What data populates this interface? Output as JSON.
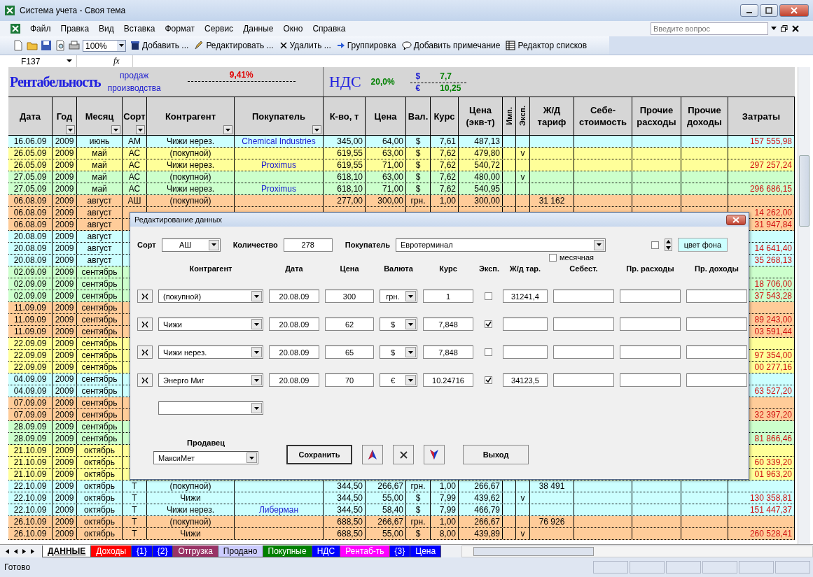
{
  "window": {
    "title": "Система учета  - Своя тема"
  },
  "menu": [
    "Файл",
    "Правка",
    "Вид",
    "Вставка",
    "Формат",
    "Сервис",
    "Данные",
    "Окно",
    "Справка"
  ],
  "help": {
    "placeholder": "Введите вопрос"
  },
  "toolbar": {
    "zoom": "100%",
    "items": [
      {
        "kind": "add",
        "label": "Добавить ..."
      },
      {
        "kind": "edit",
        "label": "Редактировать ..."
      },
      {
        "kind": "delete",
        "label": "Удалить ..."
      },
      {
        "kind": "group",
        "label": "Группировка"
      },
      {
        "kind": "comment",
        "label": "Добавить примечание"
      },
      {
        "kind": "lists",
        "label": "Редактор списков"
      }
    ]
  },
  "formula_bar": {
    "cell": "F137",
    "fx": "fx"
  },
  "summary": {
    "title": "Рентабельность",
    "sales_label": "продаж",
    "production_label": "производства",
    "profitability": "9,41%",
    "vat_title": "НДС",
    "vat": "20,0%",
    "usd_sign": "$",
    "usd": "7,7",
    "eur_sign": "€",
    "eur": "10,25"
  },
  "columns": [
    {
      "label": "Дата",
      "filter": false
    },
    {
      "label": "Год",
      "filter": true
    },
    {
      "label": "Месяц",
      "filter": true
    },
    {
      "label": "Сорт",
      "filter": true
    },
    {
      "label": "Контрагент",
      "filter": true
    },
    {
      "label": "Покупатель",
      "filter": true
    },
    {
      "label": "К-во, т",
      "filter": false
    },
    {
      "label": "Цена",
      "filter": false
    },
    {
      "label": "Вал.",
      "filter": false
    },
    {
      "label": "Курс",
      "filter": false
    },
    {
      "label": "Цена (экв-т)",
      "filter": false
    },
    {
      "label": "Имп.",
      "filter": false
    },
    {
      "label": "Эксп.",
      "filter": false
    },
    {
      "label": "Ж/Д тариф",
      "filter": false
    },
    {
      "label": "Себе-стоимость",
      "filter": false
    },
    {
      "label": "Прочие расходы",
      "filter": false
    },
    {
      "label": "Прочие доходы",
      "filter": false
    },
    {
      "label": "Затраты",
      "filter": false
    }
  ],
  "rows": [
    {
      "color": "#ccffff",
      "date": "16.06.09",
      "year": "2009",
      "month": "июнь",
      "grade": "АМ",
      "counterparty": "Чижи нерез.",
      "buyer": "Chemical Industries",
      "qty": "345,00",
      "price": "64,00",
      "currency": "$",
      "rate": "7,61",
      "price_eq": "487,13",
      "cost": "157 555,98"
    },
    {
      "color": "#ffff99",
      "date": "26.05.09",
      "year": "2009",
      "month": "май",
      "grade": "АС",
      "counterparty": "(покупной)",
      "qty": "619,55",
      "price": "63,00",
      "currency": "$",
      "rate": "7,62",
      "price_eq": "479,80",
      "exp": "v"
    },
    {
      "color": "#ffff99",
      "date": "26.05.09",
      "year": "2009",
      "month": "май",
      "grade": "АС",
      "counterparty": "Чижи нерез.",
      "buyer": "Proximus",
      "qty": "619,55",
      "price": "71,00",
      "currency": "$",
      "rate": "7,62",
      "price_eq": "540,72",
      "cost": "297 257,24"
    },
    {
      "color": "#ccffcc",
      "date": "27.05.09",
      "year": "2009",
      "month": "май",
      "grade": "АС",
      "counterparty": "(покупной)",
      "qty": "618,10",
      "price": "63,00",
      "currency": "$",
      "rate": "7,62",
      "price_eq": "480,00",
      "exp": "v"
    },
    {
      "color": "#ccffcc",
      "date": "27.05.09",
      "year": "2009",
      "month": "май",
      "grade": "АС",
      "counterparty": "Чижи нерез.",
      "buyer": "Proximus",
      "qty": "618,10",
      "price": "71,00",
      "currency": "$",
      "rate": "7,62",
      "price_eq": "540,95",
      "cost": "296 686,15"
    },
    {
      "color": "#ffcc99",
      "date": "06.08.09",
      "year": "2009",
      "month": "август",
      "grade": "АШ",
      "counterparty": "(покупной)",
      "qty": "277,00",
      "price": "300,00",
      "currency": "грн.",
      "rate": "1,00",
      "price_eq": "300,00",
      "rail": "31 162"
    },
    {
      "color": "#ffcc99",
      "date": "06.08.09",
      "year": "2009",
      "month": "август",
      "cost": "14 262,00"
    },
    {
      "color": "#ffcc99",
      "date": "06.08.09",
      "year": "2009",
      "month": "август",
      "cost": "31 947,84"
    },
    {
      "color": "#ccffff",
      "date": "20.08.09",
      "year": "2009",
      "month": "август"
    },
    {
      "color": "#ccffff",
      "date": "20.08.09",
      "year": "2009",
      "month": "август",
      "cost": "14 641,40"
    },
    {
      "color": "#ccffff",
      "date": "20.08.09",
      "year": "2009",
      "month": "август",
      "cost": "35 268,13"
    },
    {
      "color": "#ccffcc",
      "date": "02.09.09",
      "year": "2009",
      "month": "сентябрь"
    },
    {
      "color": "#ccffcc",
      "date": "02.09.09",
      "year": "2009",
      "month": "сентябрь",
      "cost": "18 706,00"
    },
    {
      "color": "#ccffcc",
      "date": "02.09.09",
      "year": "2009",
      "month": "сентябрь",
      "cost": "37 543,28"
    },
    {
      "color": "#ffcc99",
      "date": "11.09.09",
      "year": "2009",
      "month": "сентябрь"
    },
    {
      "color": "#ffcc99",
      "date": "11.09.09",
      "year": "2009",
      "month": "сентябрь",
      "cost": "89 243,00"
    },
    {
      "color": "#ffcc99",
      "date": "11.09.09",
      "year": "2009",
      "month": "сентябрь",
      "cost": "03 591,44"
    },
    {
      "color": "#ffff99",
      "date": "22.09.09",
      "year": "2009",
      "month": "сентябрь"
    },
    {
      "color": "#ffff99",
      "date": "22.09.09",
      "year": "2009",
      "month": "сентябрь",
      "cost": "97 354,00"
    },
    {
      "color": "#ffff99",
      "date": "22.09.09",
      "year": "2009",
      "month": "сентябрь",
      "cost": "00 277,16"
    },
    {
      "color": "#ccffff",
      "date": "04.09.09",
      "year": "2009",
      "month": "сентябрь"
    },
    {
      "color": "#ccffff",
      "date": "04.09.09",
      "year": "2009",
      "month": "сентябрь",
      "cost": "63 527,20"
    },
    {
      "color": "#ffcc99",
      "date": "07.09.09",
      "year": "2009",
      "month": "сентябрь"
    },
    {
      "color": "#ffcc99",
      "date": "07.09.09",
      "year": "2009",
      "month": "сентябрь",
      "cost": "32 397,20"
    },
    {
      "color": "#ccffcc",
      "date": "28.09.09",
      "year": "2009",
      "month": "сентябрь"
    },
    {
      "color": "#ccffcc",
      "date": "28.09.09",
      "year": "2009",
      "month": "сентябрь",
      "cost": "81 866,46"
    },
    {
      "color": "#ffff99",
      "date": "21.10.09",
      "year": "2009",
      "month": "октябрь"
    },
    {
      "color": "#ffff99",
      "date": "21.10.09",
      "year": "2009",
      "month": "октябрь",
      "cost": "60 339,20"
    },
    {
      "color": "#ffff99",
      "date": "21.10.09",
      "year": "2009",
      "month": "октябрь",
      "cost": "01 963,20"
    },
    {
      "color": "#ccffff",
      "date": "22.10.09",
      "year": "2009",
      "month": "октябрь",
      "grade": "Т",
      "counterparty": "(покупной)",
      "qty": "344,50",
      "price": "266,67",
      "currency": "грн.",
      "rate": "1,00",
      "price_eq": "266,67",
      "rail": "38 491"
    },
    {
      "color": "#ccffff",
      "date": "22.10.09",
      "year": "2009",
      "month": "октябрь",
      "grade": "Т",
      "counterparty": "Чижи",
      "qty": "344,50",
      "price": "55,00",
      "currency": "$",
      "rate": "7,99",
      "price_eq": "439,62",
      "exp": "v",
      "cost": "130 358,81"
    },
    {
      "color": "#ccffff",
      "date": "22.10.09",
      "year": "2009",
      "month": "октябрь",
      "grade": "Т",
      "counterparty": "Чижи нерез.",
      "buyer": "Либерман",
      "qty": "344,50",
      "price": "58,40",
      "currency": "$",
      "rate": "7,99",
      "price_eq": "466,79",
      "cost": "151 447,37"
    },
    {
      "color": "#ffcc99",
      "date": "26.10.09",
      "year": "2009",
      "month": "октябрь",
      "grade": "Т",
      "counterparty": "(покупной)",
      "qty": "688,50",
      "price": "266,67",
      "currency": "грн.",
      "rate": "1,00",
      "price_eq": "266,67",
      "rail": "76 926"
    },
    {
      "color": "#ffcc99",
      "date": "26.10.09",
      "year": "2009",
      "month": "октябрь",
      "grade": "Т",
      "counterparty": "Чижи",
      "qty": "688,50",
      "price": "55,00",
      "currency": "$",
      "rate": "8,00",
      "price_eq": "439,89",
      "exp": "v",
      "cost": "260 528,41"
    }
  ],
  "sheet_tabs": [
    {
      "label": "ДАННЫЕ",
      "selected": true,
      "color": "#ffffff"
    },
    {
      "label": "Доходы",
      "selected": false,
      "color": "#ff0000"
    },
    {
      "label": "{1}",
      "selected": false,
      "color": "#0000ff"
    },
    {
      "label": "{2}",
      "selected": false,
      "color": "#0000ff"
    },
    {
      "label": "Отгрузка",
      "selected": false,
      "color": "#993366"
    },
    {
      "label": "Продано",
      "selected": false,
      "color": "#ccccff"
    },
    {
      "label": "Покупные",
      "selected": false,
      "color": "#008000"
    },
    {
      "label": "НДС",
      "selected": false,
      "color": "#0000ff"
    },
    {
      "label": "Рентаб-ть",
      "selected": false,
      "color": "#ff00ff"
    },
    {
      "label": "{3}",
      "selected": false,
      "color": "#0000ff"
    },
    {
      "label": "Цена",
      "selected": false,
      "color": "#0000ff"
    }
  ],
  "status_bar": {
    "text": "Готово"
  },
  "dialog": {
    "title": "Редактирование данных",
    "grade_label": "Сорт",
    "grade": "АШ",
    "qty_label": "Количество",
    "qty": "278",
    "buyer_label": "Покупатель",
    "buyer": "Евротерминал",
    "bg_checked": false,
    "bg_color_label": "цвет фона",
    "monthly_label": "месячная",
    "monthly": false,
    "headers": [
      "Контрагент",
      "Дата",
      "Цена",
      "Валюта",
      "Курс",
      "Эксп.",
      "Ж/д тар.",
      "Себест.",
      "Пр. расходы",
      "Пр. доходы"
    ],
    "lines": [
      {
        "counterparty": "(покупной)",
        "date": "20.08.09",
        "price": "300",
        "currency": "грн.",
        "rate": "1",
        "exp": false,
        "rail": "31241,4"
      },
      {
        "counterparty": "Чижи",
        "date": "20.08.09",
        "price": "62",
        "currency": "$",
        "rate": "7,848",
        "exp": true
      },
      {
        "counterparty": "Чижи нерез.",
        "date": "20.08.09",
        "price": "65",
        "currency": "$",
        "rate": "7,848",
        "exp": false
      },
      {
        "counterparty": "Энерго Миг",
        "date": "20.08.09",
        "price": "70",
        "currency": "€",
        "rate": "10.24716",
        "exp": true,
        "rail": "34123,5"
      }
    ],
    "seller_label": "Продавец",
    "seller": "МаксиМет",
    "buttons": [
      {
        "kind": "save",
        "label": "Сохранить"
      },
      {
        "kind": "up"
      },
      {
        "kind": "delete"
      },
      {
        "kind": "down"
      },
      {
        "kind": "exit",
        "label": "Выход"
      }
    ]
  }
}
